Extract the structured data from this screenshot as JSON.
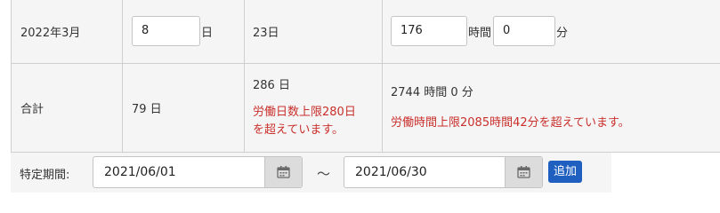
{
  "rows": {
    "month": {
      "label": "2022年3月",
      "days_value": "8",
      "days_unit": "日",
      "limit_days": "23日",
      "hours_value": "176",
      "hours_unit": "時間",
      "minutes_value": "0",
      "minutes_unit": "分"
    },
    "total": {
      "label": "合計",
      "days_total": "79 日",
      "limit_days_total": "286 日",
      "days_warning_line1": "労働日数上限280日",
      "days_warning_line2": "を超えています。",
      "hours_total": "2744 時間 0 分",
      "hours_warning": "労働時間上限2085時間42分を超えています。"
    }
  },
  "period": {
    "label": "特定期間:",
    "start_date": "2021/06/01",
    "separator": "～",
    "end_date": "2021/06/30",
    "add_label": "追加"
  },
  "colors": {
    "warning": "#c9302c",
    "add_button": "#1e5fbf"
  }
}
